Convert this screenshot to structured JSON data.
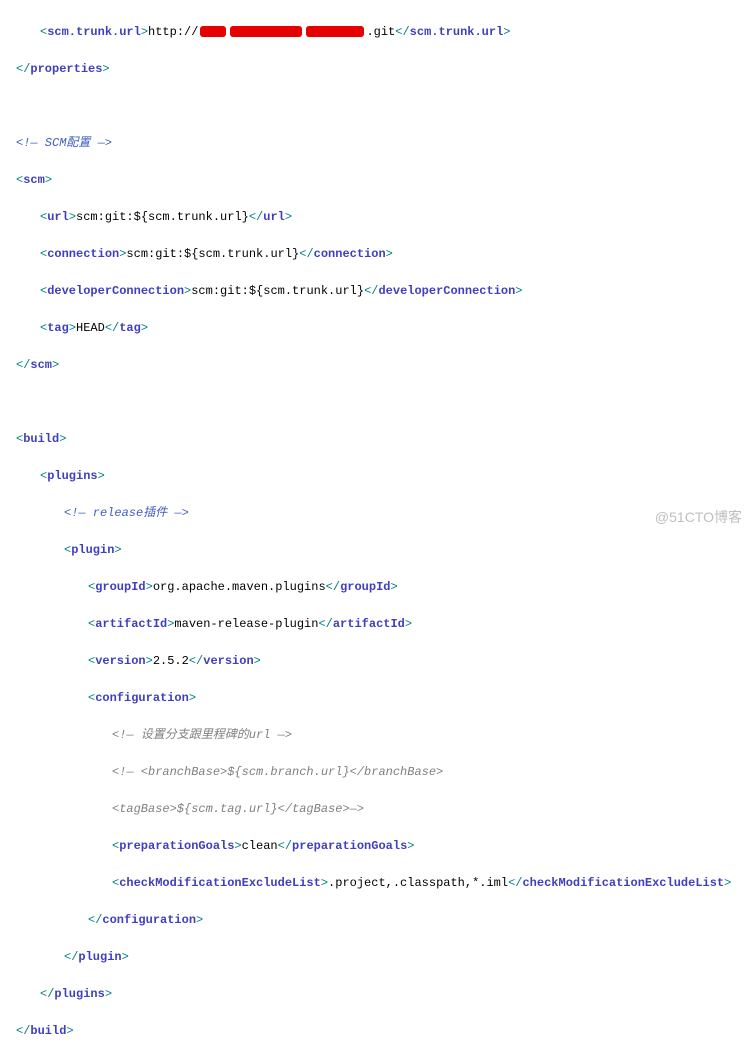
{
  "code": {
    "l1_open_tag": "scm.trunk.url",
    "l1_text_before": "http://",
    "l1_text_after": ".git",
    "l1_close_tag": "scm.trunk.url",
    "l2_close": "properties",
    "l3_comment": "<!— SCM配置 —>",
    "l4_scm": "scm",
    "l5_tag": "url",
    "l5_text": "scm:git:${scm.trunk.url}",
    "l6_tag": "connection",
    "l6_text": "scm:git:${scm.trunk.url}",
    "l7_tag": "developerConnection",
    "l7_text": "scm:git:${scm.trunk.url}",
    "l8_tag": "tag",
    "l8_text": "HEAD",
    "l9_close_scm": "scm",
    "l10_build": "build",
    "l11_plugins": "plugins",
    "l12_comment": "<!— release插件 —>",
    "l13_plugin": "plugin",
    "l14_tag": "groupId",
    "l14_text": "org.apache.maven.plugins",
    "l15_tag": "artifactId",
    "l15_text": "maven-release-plugin",
    "l16_tag": "version",
    "l16_text": "2.5.2",
    "l17_tag": "configuration",
    "l18_comment": "<!— 设置分支跟里程碑的url —>",
    "l19_comment": "<!— <branchBase>${scm.branch.url}</branchBase>",
    "l20_comment": "<tagBase>${scm.tag.url}</tagBase>—>",
    "l21_tag": "preparationGoals",
    "l21_text": "clean",
    "l22_tag": "checkModificationExcludeList",
    "l22_text": ".project,.classpath,*.iml",
    "l23_close": "configuration",
    "l24_close": "plugin",
    "l25_close": "plugins",
    "l26_close": "build"
  },
  "watermark": "@51CTO博客"
}
